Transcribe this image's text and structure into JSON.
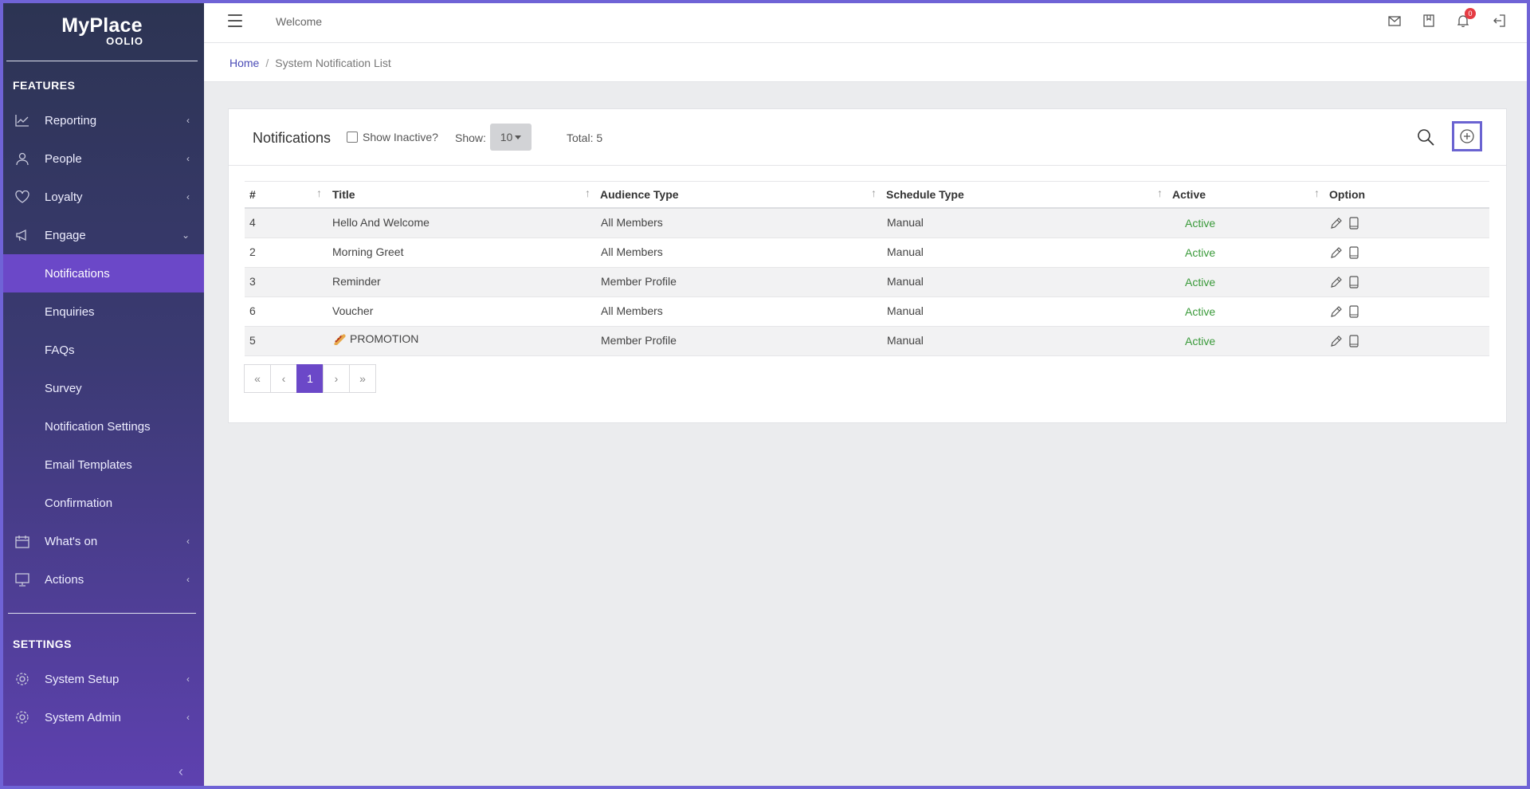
{
  "brand": {
    "name": "MyPlace",
    "sub": "OOLIO"
  },
  "sidebar": {
    "features_title": "FEATURES",
    "settings_title": "SETTINGS",
    "items": [
      {
        "label": "Reporting"
      },
      {
        "label": "People"
      },
      {
        "label": "Loyalty"
      },
      {
        "label": "Engage"
      },
      {
        "label": "Notifications"
      },
      {
        "label": "Enquiries"
      },
      {
        "label": "FAQs"
      },
      {
        "label": "Survey"
      },
      {
        "label": "Notification Settings"
      },
      {
        "label": "Email Templates"
      },
      {
        "label": "Confirmation"
      },
      {
        "label": "What's on"
      },
      {
        "label": "Actions"
      },
      {
        "label": "System Setup"
      },
      {
        "label": "System Admin"
      }
    ]
  },
  "header": {
    "welcome": "Welcome",
    "notification_count": "0"
  },
  "breadcrumb": {
    "home": "Home",
    "separator": "/",
    "current": "System Notification List"
  },
  "card": {
    "title": "Notifications",
    "show_inactive_label": "Show Inactive?",
    "show_label": "Show:",
    "show_value": "10",
    "total": "Total: 5"
  },
  "table": {
    "columns": [
      "#",
      "Title",
      "Audience Type",
      "Schedule Type",
      "Active",
      "Option"
    ],
    "rows": [
      {
        "id": "4",
        "title": "Hello And Welcome",
        "audience": "All Members",
        "schedule": "Manual",
        "active": "Active"
      },
      {
        "id": "2",
        "title": "Morning Greet",
        "audience": "All Members",
        "schedule": "Manual",
        "active": "Active"
      },
      {
        "id": "3",
        "title": "Reminder",
        "audience": "Member Profile",
        "schedule": "Manual",
        "active": "Active"
      },
      {
        "id": "6",
        "title": "Voucher",
        "audience": "All Members",
        "schedule": "Manual",
        "active": "Active"
      },
      {
        "id": "5",
        "title": "PROMOTION",
        "audience": "Member Profile",
        "schedule": "Manual",
        "active": "Active"
      }
    ]
  },
  "pagination": {
    "first": "«",
    "prev": "‹",
    "current": "1",
    "next": "›",
    "last": "»"
  },
  "colors": {
    "accent": "#6b48c8",
    "active_text": "#3a9a3a",
    "badge": "#e53b43"
  }
}
